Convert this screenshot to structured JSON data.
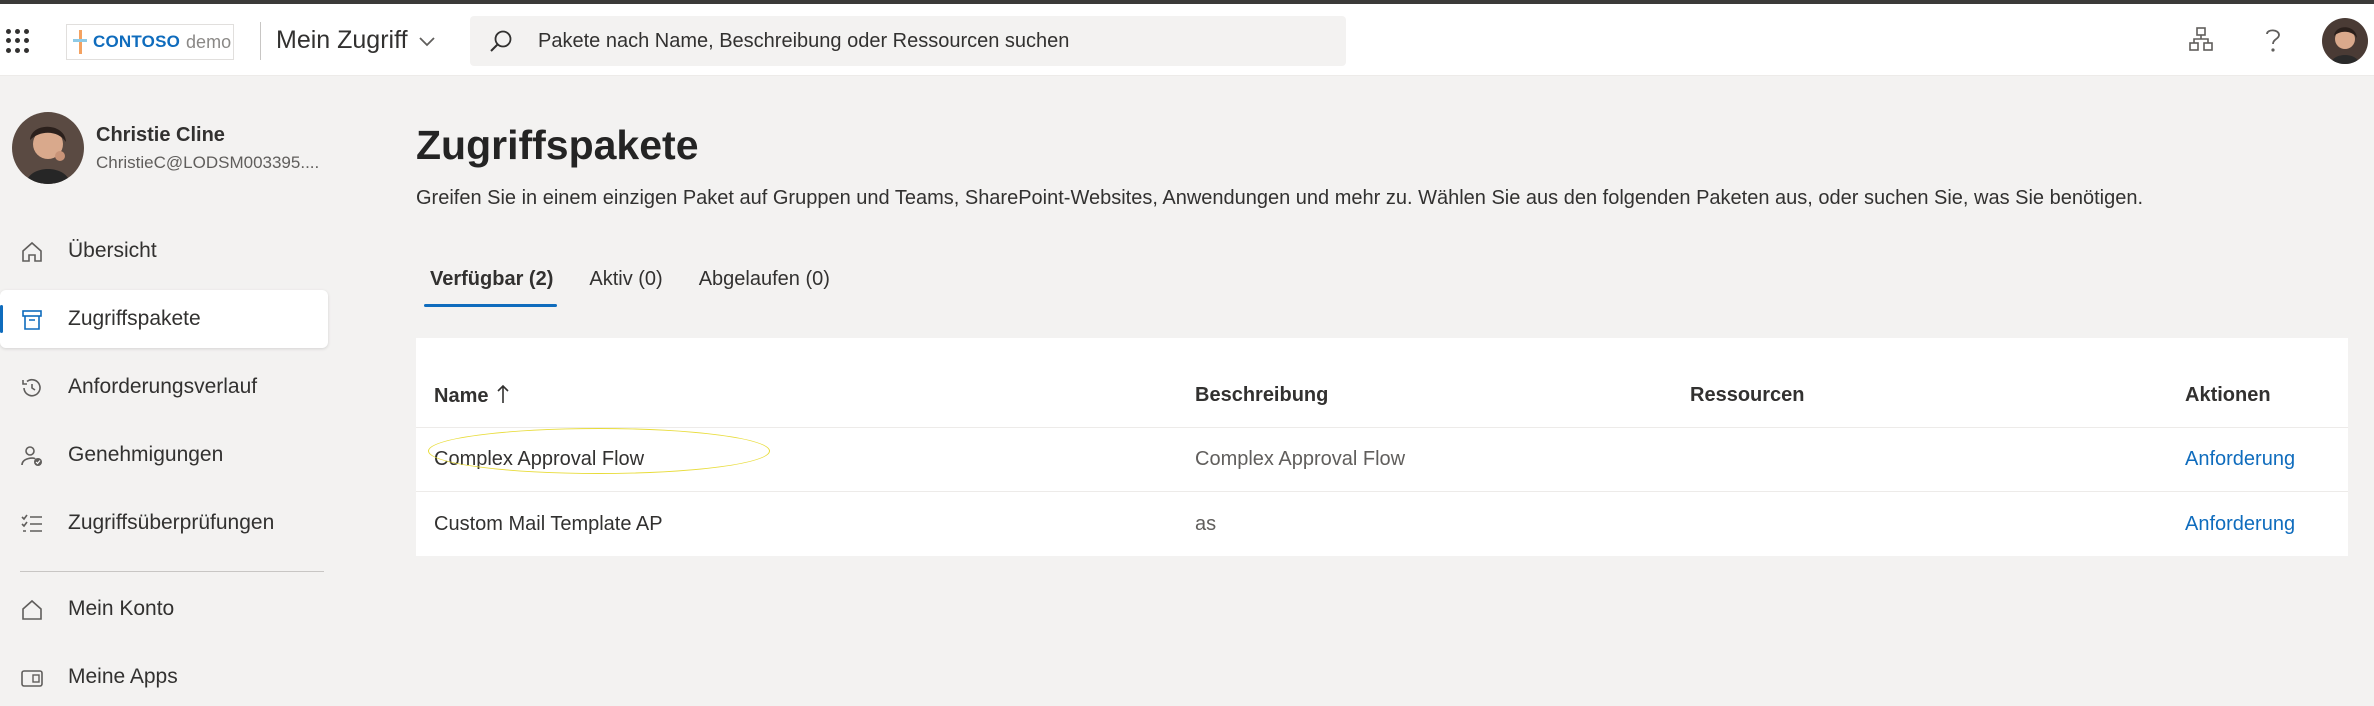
{
  "header": {
    "logo_brand": "CONTOSO",
    "logo_suffix": "demo",
    "app_name": "Mein Zugriff",
    "search_placeholder": "Pakete nach Name, Beschreibung oder Ressourcen suchen"
  },
  "user": {
    "name": "Christie Cline",
    "email": "ChristieC@LODSM003395...."
  },
  "sidebar": {
    "items": [
      {
        "label": "Übersicht",
        "icon": "home-icon",
        "active": false
      },
      {
        "label": "Zugriffspakete",
        "icon": "package-icon",
        "active": true
      },
      {
        "label": "Anforderungsverlauf",
        "icon": "history-icon",
        "active": false
      },
      {
        "label": "Genehmigungen",
        "icon": "approvals-icon",
        "active": false
      },
      {
        "label": "Zugriffsüberprüfungen",
        "icon": "checklist-icon",
        "active": false
      },
      {
        "label": "Mein Konto",
        "icon": "account-icon",
        "active": false
      },
      {
        "label": "Meine Apps",
        "icon": "apps-icon",
        "active": false
      }
    ]
  },
  "main": {
    "title": "Zugriffspakete",
    "description": "Greifen Sie in einem einzigen Paket auf Gruppen und Teams, SharePoint-Websites, Anwendungen und mehr zu. Wählen Sie aus den folgenden Paketen aus, oder suchen Sie, was Sie benötigen.",
    "tabs": [
      {
        "label": "Verfügbar (2)",
        "active": true
      },
      {
        "label": "Aktiv (0)",
        "active": false
      },
      {
        "label": "Abgelaufen (0)",
        "active": false
      }
    ],
    "table": {
      "columns": [
        "Name",
        "Beschreibung",
        "Ressourcen",
        "Aktionen"
      ],
      "rows": [
        {
          "name": "Complex Approval Flow",
          "description": "Complex Approval Flow",
          "resources": "",
          "action": "Anforderung"
        },
        {
          "name": "Custom Mail Template AP",
          "description": "as",
          "resources": "",
          "action": "Anforderung"
        }
      ]
    }
  },
  "colors": {
    "accent": "#0f6cbd",
    "highlight": "#e8dc3a",
    "background": "#f3f2f1"
  }
}
